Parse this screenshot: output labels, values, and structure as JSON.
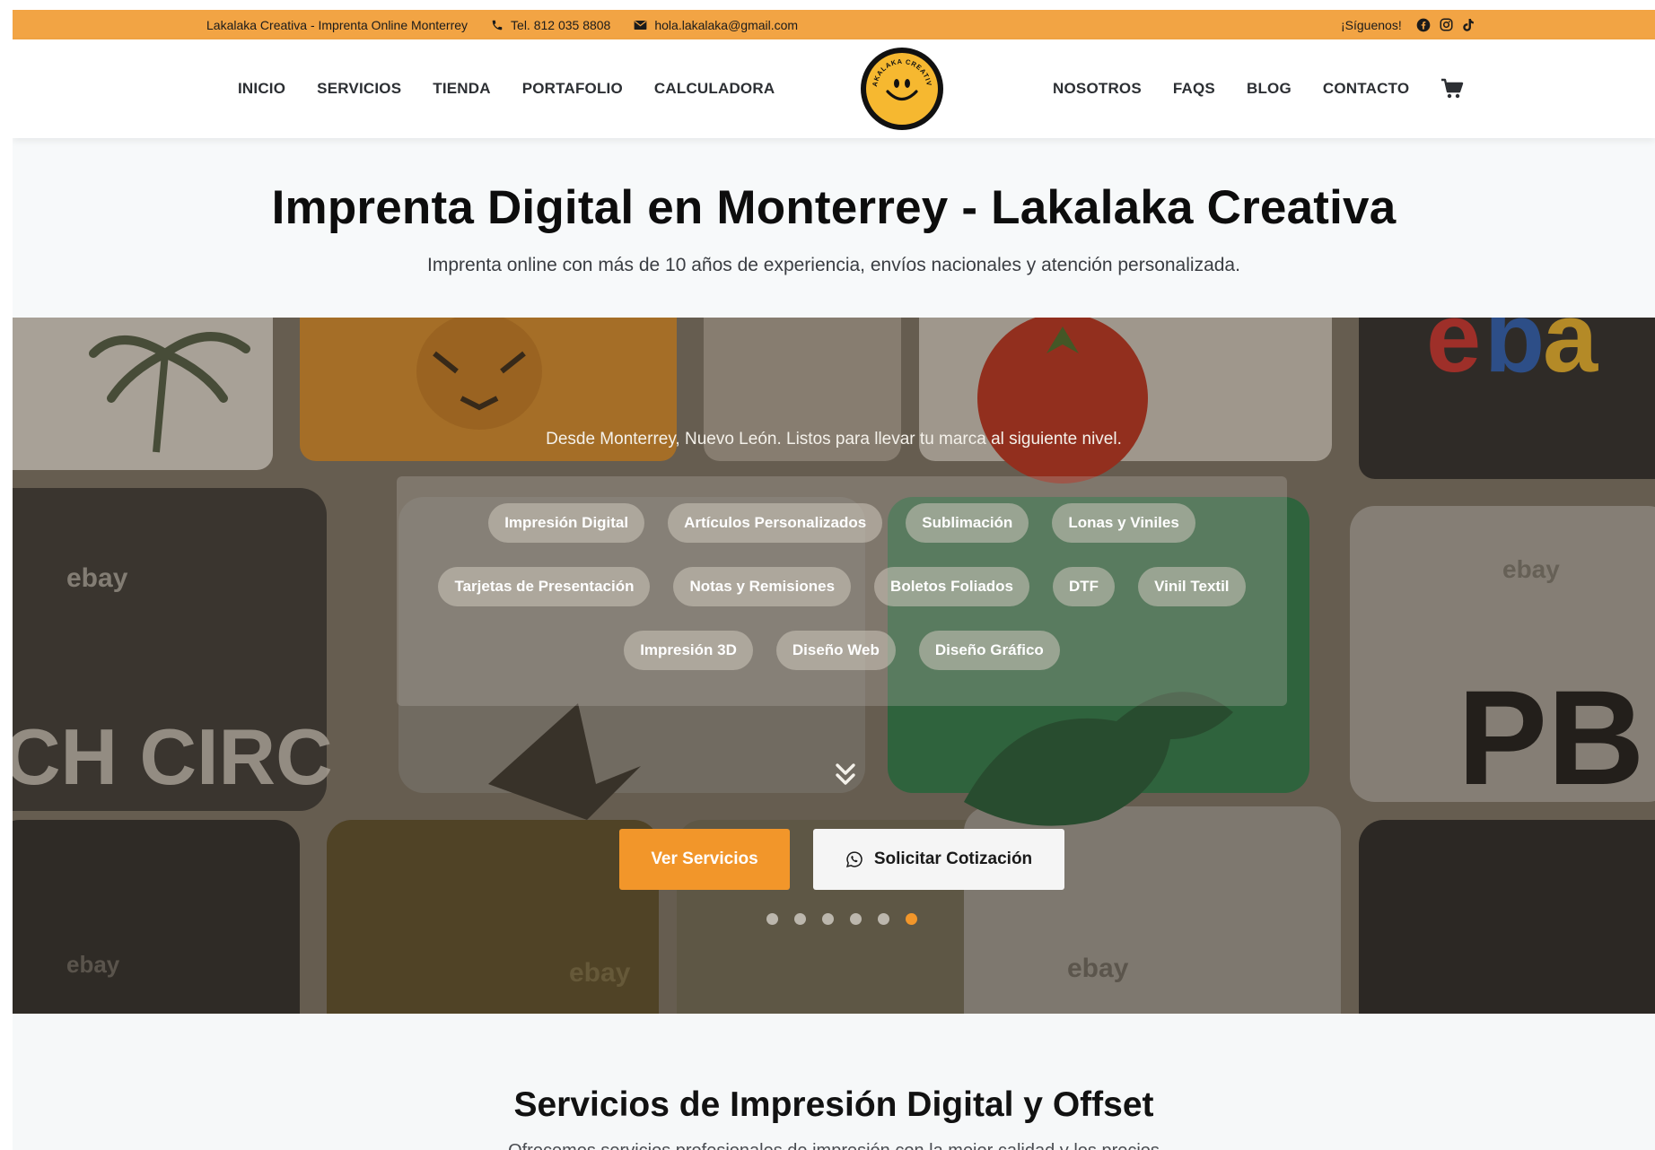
{
  "topbar": {
    "brand_text": "Lakalaka Creativa - Imprenta Online Monterrey",
    "phone": "Tel. 812 035 8808",
    "email": "hola.lakalaka@gmail.com",
    "follow_text": "¡Síguenos!",
    "social_icons": [
      "facebook-icon",
      "instagram-icon",
      "tiktok-icon"
    ]
  },
  "nav": {
    "left_items": [
      "INICIO",
      "SERVICIOS",
      "TIENDA",
      "PORTAFOLIO",
      "CALCULADORA"
    ],
    "right_items": [
      "NOSOTROS",
      "FAQS",
      "BLOG",
      "CONTACTO"
    ],
    "logo_text": "LAKALAKA CREATIVA",
    "cart_icon": "cart-icon"
  },
  "hero": {
    "title": "Imprenta Digital en Monterrey - Lakalaka Creativa",
    "subtitle": "Imprenta online con más de 10 años de experiencia, envíos nacionales y atención personalizada."
  },
  "banner": {
    "tagline": "Desde Monterrey, Nuevo León. Listos para llevar tu marca al siguiente nivel.",
    "chips_row1": [
      "Impresión Digital",
      "Artículos Personalizados",
      "Sublimación",
      "Lonas y Viniles"
    ],
    "chips_row2": [
      "Tarjetas de Presentación",
      "Notas y Remisiones",
      "Boletos Foliados",
      "DTF",
      "Vinil Textil"
    ],
    "chips_row3": [
      "Impresión 3D",
      "Diseño Web",
      "Diseño Gráfico"
    ],
    "primary_button": "Ver Servicios",
    "secondary_button": "Solicitar Cotización",
    "slide_count": 6,
    "active_slide": 6,
    "colors": {
      "accent": "#f2962a",
      "topbar": "#f2a444"
    }
  },
  "services": {
    "title": "Servicios de Impresión Digital y Offset",
    "intro": "Ofrecemos servicios profesionales de impresión con la mejor calidad y los precios"
  }
}
